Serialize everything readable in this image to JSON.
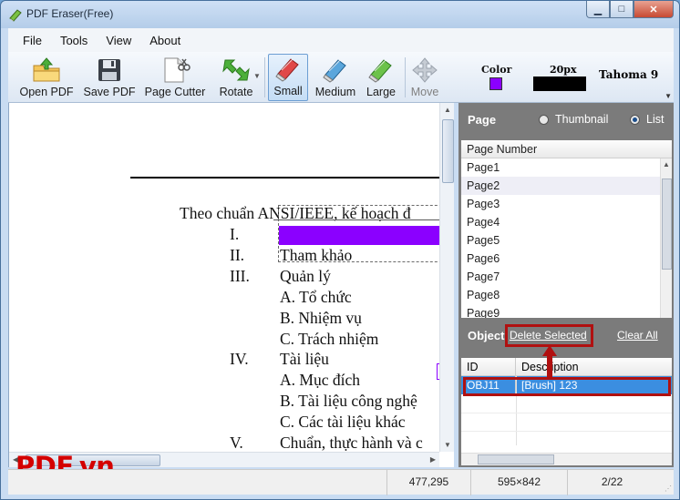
{
  "window": {
    "title": "PDF Eraser(Free)",
    "min_glyph": "▁",
    "max_glyph": "□",
    "close_glyph": "✕"
  },
  "menu": [
    "File",
    "Tools",
    "View",
    "About"
  ],
  "toolbar": {
    "open_pdf": "Open PDF",
    "save_pdf": "Save PDF",
    "page_cutter": "Page Cutter",
    "rotate": "Rotate",
    "small": "Small",
    "medium": "Medium",
    "large": "Large",
    "move": "Move",
    "color_label": "Color",
    "color_value": "#8b00ff",
    "size_label": "20px",
    "font_label": "Tahoma 9",
    "selected_tool": "Small"
  },
  "document": {
    "lines": [
      "Theo chuẩn ANSI/IEEE, kế hoạch đ",
      "I.",
      "II.",
      "Tham khảo",
      "III.",
      "Quản lý",
      "A.  Tổ chức",
      "B.  Nhiệm vụ",
      "C.  Trách nhiệm",
      "IV.",
      "Tài liệu",
      "A.  Mục đích",
      "B.  Tài liệu công nghệ",
      "C.  Các tài liệu khác",
      "V.",
      "Chuẩn, thực hành và c"
    ]
  },
  "watermark": "PDF.vn",
  "page_panel": {
    "title": "Page",
    "view_options": [
      "Thumbnail",
      "List"
    ],
    "selected_view": "List",
    "list_header": "Page Number",
    "pages": [
      "Page1",
      "Page2",
      "Page3",
      "Page4",
      "Page5",
      "Page6",
      "Page7",
      "Page8",
      "Page9"
    ]
  },
  "object_panel": {
    "title": "Object",
    "delete_selected": "Delete Selected",
    "clear_all": "Clear All",
    "columns": [
      "ID",
      "Description"
    ],
    "rows": [
      {
        "id": "OBJ11",
        "description": "[Brush] 123"
      }
    ]
  },
  "status": {
    "coords": "477,295",
    "page_size": "595×842",
    "page_index": "2/22"
  }
}
